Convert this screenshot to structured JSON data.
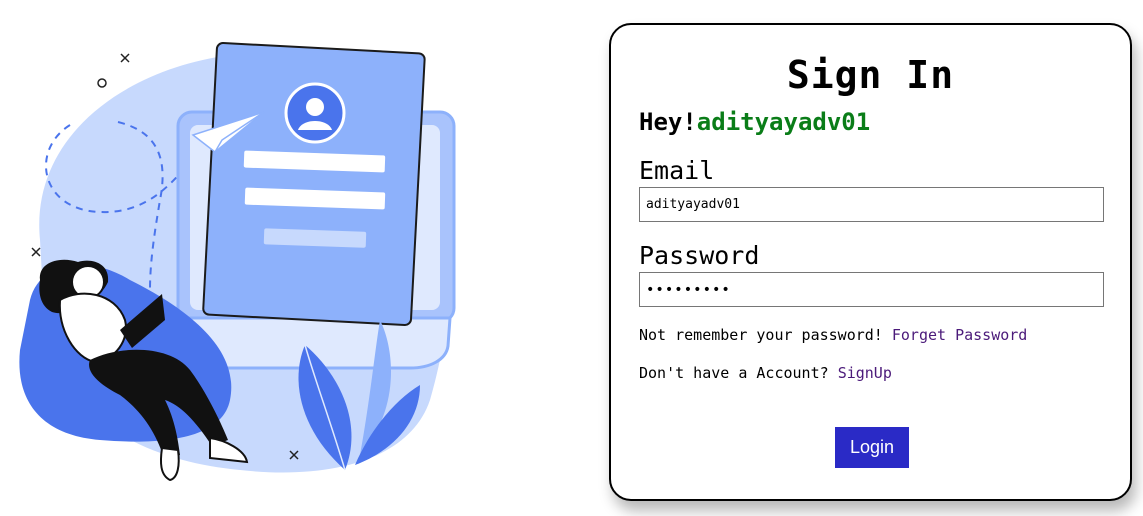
{
  "signin": {
    "title": "Sign In",
    "greeting_prefix": "Hey!",
    "username": "adityayadv01",
    "email_label": "Email",
    "email_value": "adityayadv01",
    "password_label": "Password",
    "password_value": "abcdefghi",
    "forget_prompt": "Not remember your password!",
    "forget_link": "Forget Password",
    "signup_prompt": "Don't have a Account?",
    "signup_link": "SignUp",
    "login_button": "Login"
  },
  "colors": {
    "username": "#0a7d18",
    "link": "#4b1a7a",
    "button": "#2a2ac6",
    "illustration_light": "#c7d9fd",
    "illustration_mid": "#8db1fb",
    "illustration_dark": "#4a74ec"
  },
  "illustration": {
    "icons": [
      "user-avatar-icon",
      "paper-plane-icon",
      "laptop-icon",
      "leaf-icon"
    ]
  }
}
